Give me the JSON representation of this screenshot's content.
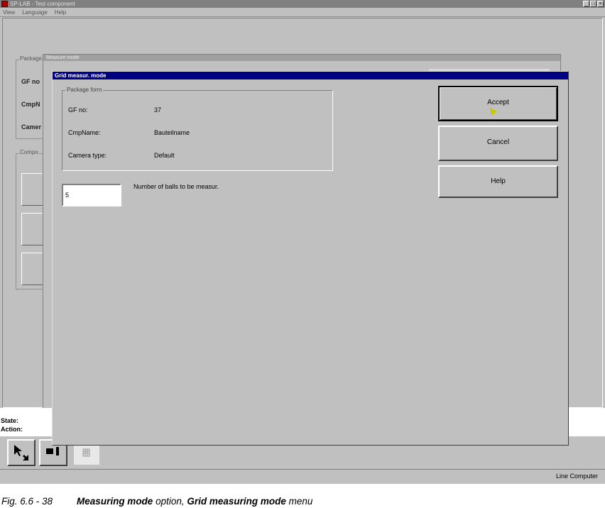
{
  "app": {
    "title": "SP-LAB - Test component",
    "menu": [
      "View",
      "Language",
      "Help"
    ],
    "controls": [
      "_",
      "□",
      "×"
    ]
  },
  "background_window": {
    "title": "Measure mode",
    "group_label": "Package",
    "labels": [
      "GF no",
      "CmpN",
      "Camer"
    ],
    "group2_label": "Compo"
  },
  "status": {
    "state_label": "State:",
    "action_label": "Action:",
    "right_text": "Line Computer"
  },
  "dialog": {
    "title": "Grid measur. mode",
    "group_label": "Package form",
    "fields": [
      {
        "label": "GF no:",
        "value": "37"
      },
      {
        "label": "CmpName:",
        "value": "Bauteilname"
      },
      {
        "label": "Camera type:",
        "value": "Default"
      }
    ],
    "balls_value": "5",
    "balls_label": "Number of balls to be measur.",
    "buttons": {
      "accept": "Accept",
      "cancel": "Cancel",
      "help": "Help"
    }
  },
  "caption": {
    "figure": "Fig. 6.6 - 38",
    "part1": "Measuring mode",
    "part2": " option, ",
    "part3": "Grid measuring mode",
    "part4": " menu"
  },
  "icons": {
    "tool1": "pointer-select-icon",
    "tool2": "block-marker-icon",
    "tool3": "grid-icon"
  }
}
